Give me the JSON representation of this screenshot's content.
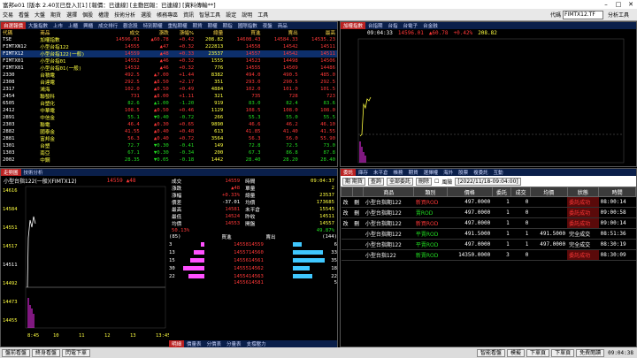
{
  "window": {
    "title": "富邦e01 [版本 2.40][已登入][1] [報價：已連線] [主動回報：已連線] [資料傳輸**]"
  },
  "menu": {
    "items": [
      "交易",
      "看盤",
      "大盤",
      "期貨",
      "選擇",
      "個股",
      "權證",
      "技術分析",
      "選股",
      "帳務專區",
      "資訊",
      "智慧工具",
      "設定",
      "說明",
      "工具"
    ],
    "symbol": "FIMTX12.TF",
    "symbol_label": "代碼",
    "analysis": "分析工具"
  },
  "quote": {
    "tabs": [
      "自選報價",
      "大盤指數",
      "上市",
      "上櫃",
      "興櫃",
      "成交排行",
      "觀念股",
      "特別期權",
      "重點期權",
      "期貨",
      "期權",
      "期指",
      "國際指數",
      "夜盤",
      "商品"
    ],
    "headers": [
      "代碼",
      "商品",
      "成交",
      "漲跌",
      "漲幅%",
      "總量",
      "買進",
      "賣出",
      "最高",
      "最低",
      "昨收"
    ],
    "rows": [
      {
        "c": [
          "TSE",
          "加權指數",
          "14596.01",
          "▲60.78",
          "+0.42",
          "208.82",
          "14608.43",
          "14584.33",
          "14535.23"
        ],
        "color": "red"
      },
      {
        "c": [
          "FIMTXN12",
          "小型台指122",
          "14555",
          "▲47",
          "+0.32",
          "222813",
          "14558",
          "14542",
          "14511"
        ],
        "color": "red"
      },
      {
        "c": [
          "FIMTX12",
          "小型台指122(一般)",
          "14559",
          "▲48",
          "+0.33",
          "23537",
          "14557",
          "14542",
          "14511"
        ],
        "color": "red",
        "sel": true
      },
      {
        "c": [
          "FIMTX01",
          "小型台指01",
          "14552",
          "▲46",
          "+0.32",
          "1555",
          "14523",
          "14498",
          "14506"
        ],
        "color": "red"
      },
      {
        "c": [
          "FIMTX01",
          "小型台指01(一般)",
          "14532",
          "▲46",
          "+0.32",
          "776",
          "14555",
          "14509",
          "14486"
        ],
        "color": "red"
      },
      {
        "c": [
          "2330",
          "台積電",
          "492.5",
          "▲7.00",
          "+1.44",
          "8382",
          "494.0",
          "490.5",
          "485.0"
        ],
        "color": "red"
      },
      {
        "c": [
          "2308",
          "台達電",
          "292.5",
          "▲8.50",
          "+2.17",
          "351",
          "293.0",
          "290.5",
          "292.5"
        ],
        "color": "red"
      },
      {
        "c": [
          "2317",
          "鴻海",
          "102.0",
          "▲0.50",
          "+0.49",
          "4884",
          "102.0",
          "101.0",
          "101.5"
        ],
        "color": "red"
      },
      {
        "c": [
          "2454",
          "聯發科",
          "731",
          "▲8.00",
          "+1.11",
          "321",
          "735",
          "728",
          "723"
        ],
        "color": "red"
      },
      {
        "c": [
          "6505",
          "台塑化",
          "82.6",
          "▲1.00",
          "-1.20",
          "919",
          "83.0",
          "82.4",
          "83.6"
        ],
        "color": "grn"
      },
      {
        "c": [
          "2412",
          "中華電",
          "108.5",
          "▲0.50",
          "+0.46",
          "1129",
          "108.5",
          "108.0",
          "108.0"
        ],
        "color": "red"
      },
      {
        "c": [
          "2891",
          "中信金",
          "55.1",
          "▼0.40",
          "-0.72",
          "266",
          "55.3",
          "55.0",
          "55.5"
        ],
        "color": "grn"
      },
      {
        "c": [
          "2303",
          "聯電",
          "46.4",
          "▲0.30",
          "+0.65",
          "9890",
          "46.6",
          "46.2",
          "46.10"
        ],
        "color": "red"
      },
      {
        "c": [
          "2882",
          "國泰金",
          "41.55",
          "▲0.40",
          "+0.48",
          "613",
          "41.85",
          "41.40",
          "41.55"
        ],
        "color": "red"
      },
      {
        "c": [
          "2881",
          "富邦金",
          "56.3",
          "▲0.40",
          "+0.72",
          "3564",
          "56.3",
          "56.0",
          "55.90"
        ],
        "color": "red"
      },
      {
        "c": [
          "1301",
          "台塑",
          "72.7",
          "▼0.30",
          "-0.41",
          "149",
          "72.8",
          "72.5",
          "73.0"
        ],
        "color": "grn"
      },
      {
        "c": [
          "1303",
          "南亞",
          "67.1",
          "▼0.30",
          "-0.34",
          "200",
          "67.3",
          "86.8",
          "87.8"
        ],
        "color": "grn"
      },
      {
        "c": [
          "2002",
          "中鋼",
          "28.35",
          "▼0.05",
          "-0.18",
          "1442",
          "28.40",
          "28.20",
          "28.40"
        ],
        "color": "grn"
      }
    ]
  },
  "mini": {
    "tabs": [
      "加權指數",
      "台指期",
      "台指",
      "台電子",
      "台金融"
    ],
    "time": "09:04:33",
    "value": "14596.01",
    "change": "▲60.78",
    "pct": "+0.42%",
    "volume": "208.82",
    "y_labels": [
      "",
      "",
      "",
      ""
    ]
  },
  "tick": {
    "tabs": [
      "走勢圖",
      "技術分析"
    ],
    "title": "小型台指122(一般)(FIMTX12)",
    "price": "14559",
    "chg": "▲48",
    "y_labels": [
      "14616",
      "14584",
      "14551",
      "14517",
      "14511",
      "14492",
      "14473",
      "14455"
    ],
    "x_labels": [
      "8:45",
      "10",
      "11",
      "12",
      "13",
      "13:45"
    ],
    "bottom_tabs": [
      "明細",
      "價量表",
      "分價表",
      "分量表",
      "支撐壓力"
    ],
    "info": [
      [
        "成交",
        "14559",
        "時間",
        "09:04:37"
      ],
      [
        "漲跌",
        "▲48",
        "單量",
        "2"
      ],
      [
        "漲幅",
        "+0.33%",
        "總量",
        "23537"
      ],
      [
        "價差",
        "-37.01",
        "均價",
        "173685"
      ],
      [
        "最高",
        "14581",
        "未平倉",
        "15545"
      ],
      [
        "最低",
        "14524",
        "昨收",
        "14511"
      ],
      [
        "均價",
        "14553",
        "開盤",
        "14557"
      ]
    ],
    "bid_pct": "50.13%",
    "ask_pct": "49.87%",
    "book_head": {
      "bidn": "(85)",
      "bid": "買進",
      "ask": "賣出",
      "askn": "(144)"
    },
    "book": [
      [
        "3",
        "14558",
        "14559",
        "6"
      ],
      [
        "13",
        "14557",
        "14560",
        "33"
      ],
      [
        "15",
        "14556",
        "14561",
        "35"
      ],
      [
        "30",
        "14555",
        "14562",
        "18"
      ],
      [
        "22",
        "14554",
        "14563",
        "22"
      ]
    ],
    "book_total": [
      "14556",
      "14581",
      "5"
    ]
  },
  "orders": {
    "tabs": [
      "委託",
      "庫存",
      "未平倉",
      "帳務",
      "期貨",
      "選擇權",
      "海外",
      "股票",
      "複委託",
      "互動"
    ],
    "toolbar": {
      "account": "期 期貨",
      "query": "查詢",
      "all": "全部委託",
      "delete": "刪除",
      "risk": "風險",
      "date": "[2022/11/18-09:04:00]"
    },
    "headers": [
      "",
      "",
      "商品",
      "類別",
      "價格",
      "委託",
      "成交",
      "均價",
      "狀態",
      "時間"
    ],
    "rows": [
      [
        "改",
        "刪",
        "小型台指期122",
        "新買ROD",
        "497.0000",
        "1",
        "0",
        "",
        "委託成功",
        "08:00:14"
      ],
      [
        "改",
        "刪",
        "小型台指期122",
        "賣ROD",
        "497.0000",
        "1",
        "0",
        "",
        "委託成功",
        "09:00:58"
      ],
      [
        "改",
        "刪",
        "小型台指期122",
        "新買ROD",
        "497.0000",
        "1",
        "0",
        "",
        "委託成功",
        "09:00:14"
      ],
      [
        "",
        "",
        "小型台指期122",
        "平賣ROD",
        "491.5000",
        "1",
        "1",
        "491.5000",
        "完全成交",
        "08:51:36"
      ],
      [
        "",
        "",
        "小型台指期122",
        "平賣ROD",
        "497.0000",
        "1",
        "1",
        "497.0000",
        "完全成交",
        "08:30:19"
      ],
      [
        "",
        "",
        "小型台指122",
        "新賣ROD",
        "14350.0000",
        "3",
        "0",
        "",
        "委託成功",
        "08:30:09"
      ]
    ]
  },
  "status": {
    "left": [
      "盤前看盤",
      "終身看盤",
      "閃電下單"
    ],
    "right": [
      "智能看盤",
      "模擬",
      "下單頁",
      "下單頁",
      "免費閱讀"
    ],
    "time": "09:04:38"
  }
}
